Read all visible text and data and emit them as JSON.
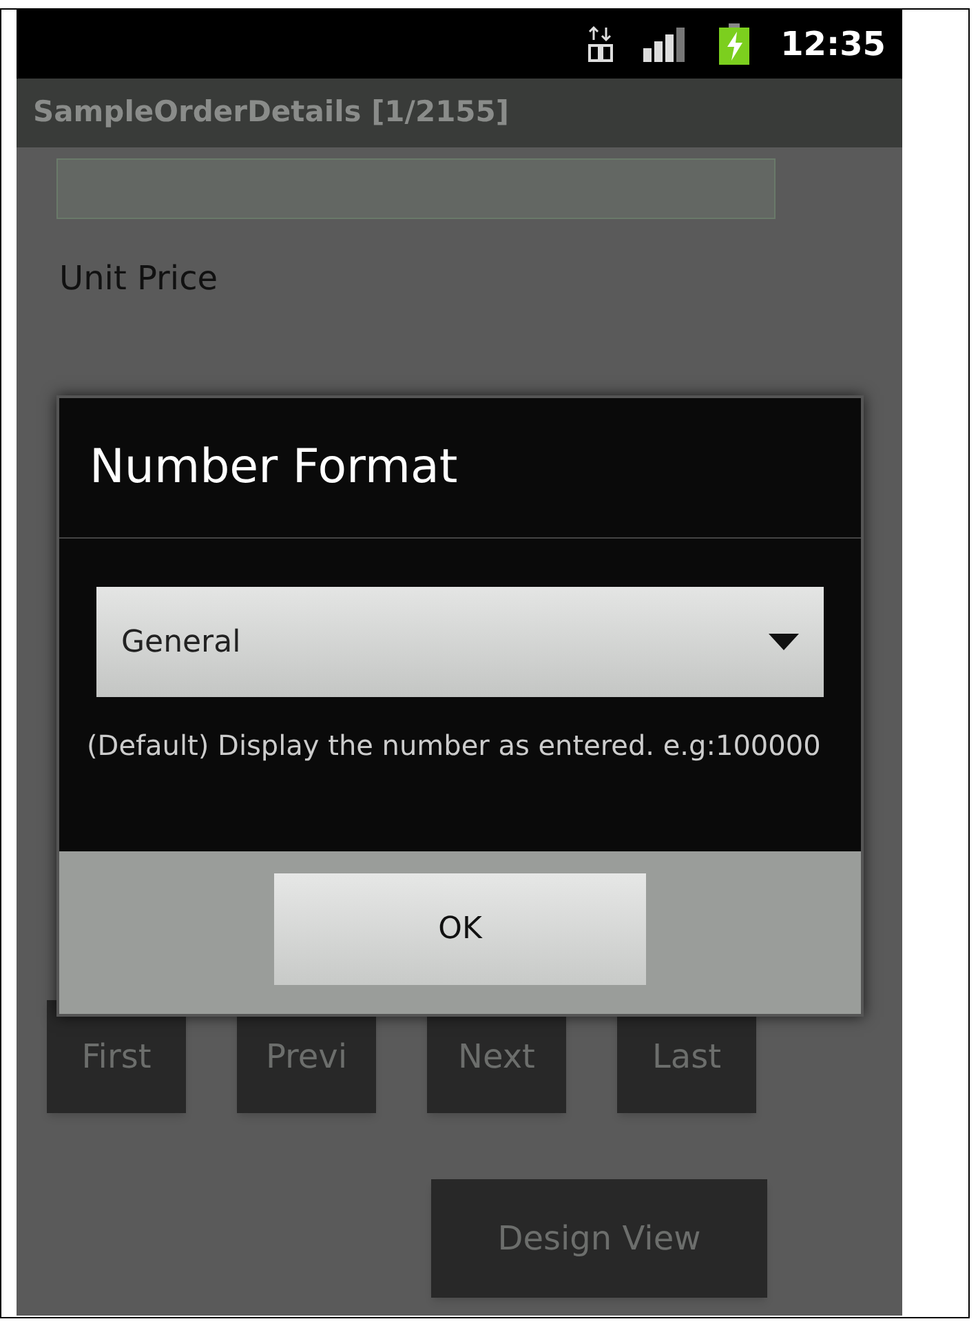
{
  "status_bar": {
    "time": "12:35"
  },
  "title_bar": {
    "title": "SampleOrderDetails [1/2155]"
  },
  "form": {
    "field_label": "Unit Price"
  },
  "dialog": {
    "title": "Number Format",
    "select": {
      "value": "General"
    },
    "description": "(Default) Display the number as entered. e.g:100000",
    "button": "OK"
  },
  "nav_buttons": [
    "First",
    "Previ",
    "Next",
    "Last"
  ],
  "design_view_button": "Design View"
}
